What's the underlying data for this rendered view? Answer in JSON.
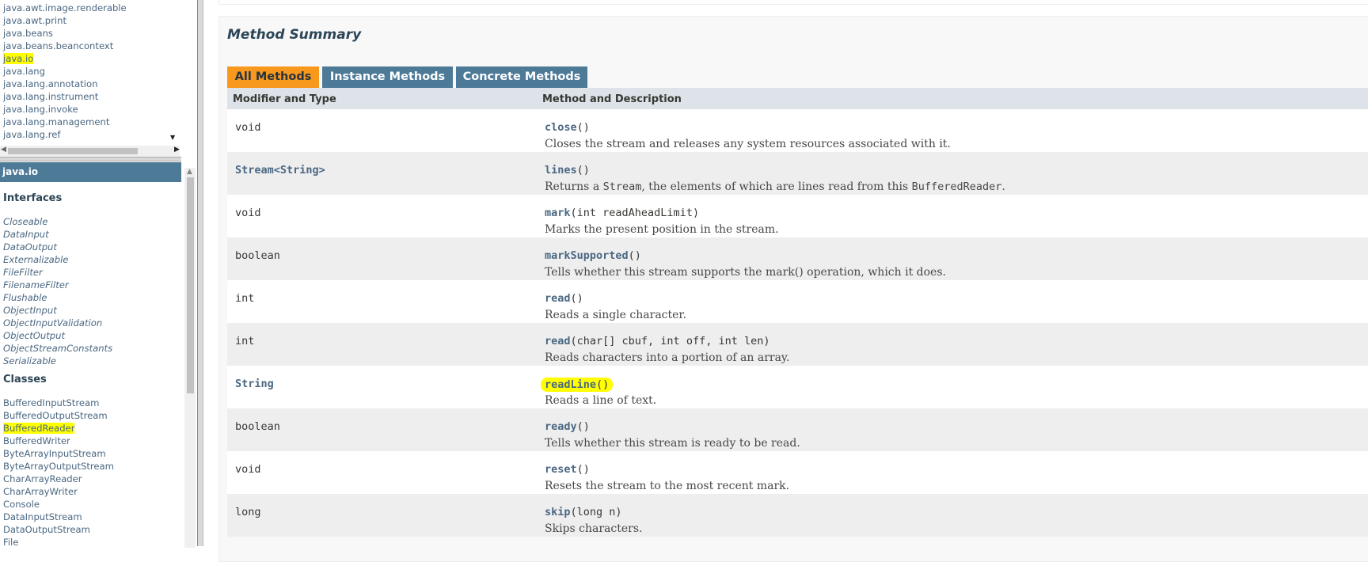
{
  "packages": [
    "java.awt.image.renderable",
    "java.awt.print",
    "java.beans",
    "java.beans.beancontext",
    "java.io",
    "java.lang",
    "java.lang.annotation",
    "java.lang.instrument",
    "java.lang.invoke",
    "java.lang.management",
    "java.lang.ref"
  ],
  "highlighted_package": "java.io",
  "class_frame": {
    "header": "java.io",
    "interfaces_title": "Interfaces",
    "interfaces": [
      "Closeable",
      "DataInput",
      "DataOutput",
      "Externalizable",
      "FileFilter",
      "FilenameFilter",
      "Flushable",
      "ObjectInput",
      "ObjectInputValidation",
      "ObjectOutput",
      "ObjectStreamConstants",
      "Serializable"
    ],
    "classes_title": "Classes",
    "classes": [
      "BufferedInputStream",
      "BufferedOutputStream",
      "BufferedReader",
      "BufferedWriter",
      "ByteArrayInputStream",
      "ByteArrayOutputStream",
      "CharArrayReader",
      "CharArrayWriter",
      "Console",
      "DataInputStream",
      "DataOutputStream",
      "File"
    ],
    "highlighted_class": "BufferedReader"
  },
  "summary": {
    "title": "Method Summary",
    "tabs": [
      "All Methods",
      "Instance Methods",
      "Concrete Methods"
    ],
    "active_tab": "All Methods",
    "col_headers": [
      "Modifier and Type",
      "Method and Description"
    ],
    "methods": [
      {
        "type": "void",
        "name": "close",
        "params": "()",
        "desc": "Closes the stream and releases any system resources associated with it."
      },
      {
        "type": "Stream<String>",
        "name": "lines",
        "params": "()",
        "desc_pre": "Returns a ",
        "desc_code1": "Stream",
        "desc_mid": ", the elements of which are lines read from this ",
        "desc_code2": "BufferedReader",
        "desc_post": "."
      },
      {
        "type": "void",
        "name": "mark",
        "params": "(int readAheadLimit)",
        "desc": "Marks the present position in the stream."
      },
      {
        "type": "boolean",
        "name": "markSupported",
        "params": "()",
        "desc": "Tells whether this stream supports the mark() operation, which it does."
      },
      {
        "type": "int",
        "name": "read",
        "params": "()",
        "desc": "Reads a single character."
      },
      {
        "type": "int",
        "name": "read",
        "params": "(char[] cbuf, int off, int len)",
        "desc": "Reads characters into a portion of an array."
      },
      {
        "type": "String",
        "name": "readLine",
        "params": "()",
        "desc": "Reads a line of text."
      },
      {
        "type": "boolean",
        "name": "ready",
        "params": "()",
        "desc": "Tells whether this stream is ready to be read."
      },
      {
        "type": "void",
        "name": "reset",
        "params": "()",
        "desc": "Resets the stream to the most recent mark."
      },
      {
        "type": "long",
        "name": "skip",
        "params": "(long n)",
        "desc": "Skips characters."
      }
    ]
  },
  "colors": {
    "highlight": "#ffff00",
    "tab_active": "#f8981d",
    "tab_inactive": "#4d7a97",
    "header_bar": "#4d7a97",
    "link": "#4a6782"
  }
}
